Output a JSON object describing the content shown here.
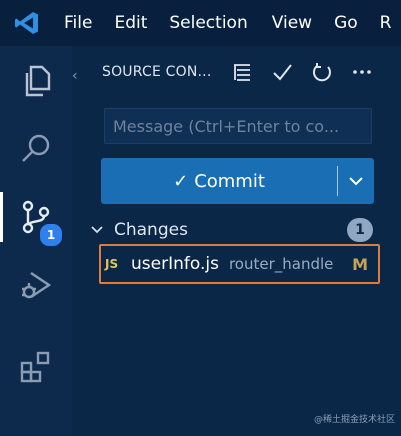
{
  "menubar": {
    "items": [
      "File",
      "Edit",
      "Selection",
      "View",
      "Go",
      "R"
    ]
  },
  "activity_bar": {
    "items": [
      {
        "name": "explorer",
        "icon": "files-icon"
      },
      {
        "name": "search",
        "icon": "search-icon"
      },
      {
        "name": "source-control",
        "icon": "source-control-icon",
        "badge": "1",
        "active": true
      },
      {
        "name": "run-debug",
        "icon": "run-debug-icon"
      },
      {
        "name": "extensions",
        "icon": "extensions-icon"
      }
    ]
  },
  "sidebar": {
    "title": "SOURCE CON...",
    "actions": [
      "view-as-tree-icon",
      "check-icon",
      "refresh-icon",
      "more-icon"
    ],
    "message_placeholder": "Message (Ctrl+Enter to co...",
    "commit_label": "Commit",
    "changes": {
      "label": "Changes",
      "count": "1",
      "files": [
        {
          "icon_label": "JS",
          "name": "userInfo.js",
          "dir": "router_handle",
          "status": "M"
        }
      ]
    }
  },
  "watermark": "@稀土掘金技术社区",
  "colors": {
    "background": "#0b2545",
    "accent_button": "#1a6fb4",
    "badge": "#2f80ed",
    "highlight_border": "#e07b39",
    "modified_status": "#c8a25a"
  }
}
